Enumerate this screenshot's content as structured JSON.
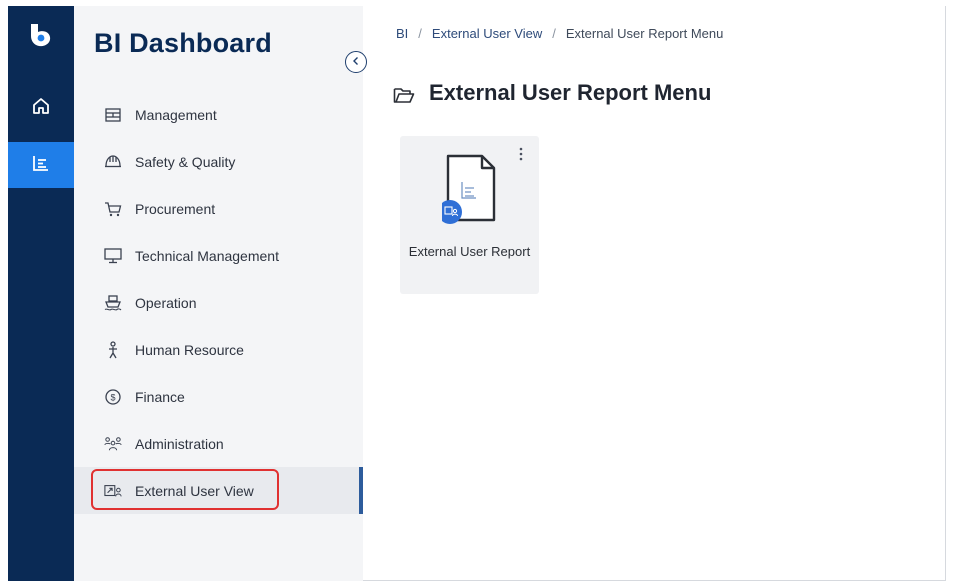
{
  "app": {
    "title": "BI Dashboard"
  },
  "rail": {
    "items": [
      {
        "icon": "home-icon"
      },
      {
        "icon": "reports-icon",
        "active": true
      }
    ]
  },
  "sidebar": {
    "items": [
      {
        "label": "Management",
        "icon": "management-icon"
      },
      {
        "label": "Safety & Quality",
        "icon": "safety-helmet-icon"
      },
      {
        "label": "Procurement",
        "icon": "cart-icon"
      },
      {
        "label": "Technical Management",
        "icon": "monitor-icon"
      },
      {
        "label": "Operation",
        "icon": "ship-icon"
      },
      {
        "label": "Human Resource",
        "icon": "person-icon"
      },
      {
        "label": "Finance",
        "icon": "dollar-icon"
      },
      {
        "label": "Administration",
        "icon": "people-icon"
      },
      {
        "label": "External User View",
        "icon": "external-user-icon",
        "active": true
      }
    ]
  },
  "breadcrumb": {
    "root": "BI",
    "level1": "External User View",
    "current": "External User Report Menu",
    "separator": "/"
  },
  "main": {
    "title": "External User Report Menu",
    "tiles": [
      {
        "label": "External User Report",
        "icon": "report-document-icon"
      }
    ]
  },
  "colors": {
    "rail_bg": "#0a2a55",
    "rail_active": "#1f7ee8",
    "sidebar_bg": "#f4f5f7",
    "highlight": "#e03131",
    "accent": "#2d5c9c"
  }
}
